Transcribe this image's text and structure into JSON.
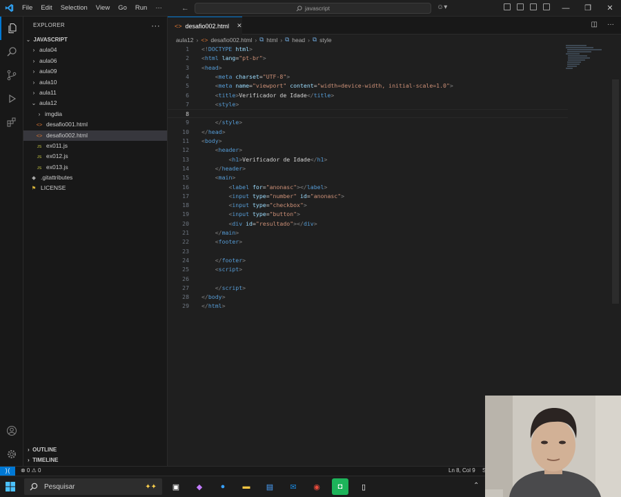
{
  "titlebar": {
    "menu": [
      "File",
      "Edit",
      "Selection",
      "View",
      "Go",
      "Run",
      "···"
    ],
    "search_text": "javascript"
  },
  "explorer": {
    "title": "EXPLORER",
    "root": "JAVASCRIPT",
    "items": [
      {
        "label": "aula04",
        "kind": "folder",
        "depth": 1,
        "open": false
      },
      {
        "label": "aula06",
        "kind": "folder",
        "depth": 1,
        "open": false
      },
      {
        "label": "aula09",
        "kind": "folder",
        "depth": 1,
        "open": false
      },
      {
        "label": "aula10",
        "kind": "folder",
        "depth": 1,
        "open": false
      },
      {
        "label": "aula11",
        "kind": "folder",
        "depth": 1,
        "open": false
      },
      {
        "label": "aula12",
        "kind": "folder",
        "depth": 1,
        "open": true
      },
      {
        "label": "imgdia",
        "kind": "folder",
        "depth": 2,
        "open": false
      },
      {
        "label": "desafio001.html",
        "kind": "html",
        "depth": 2
      },
      {
        "label": "desafio002.html",
        "kind": "html",
        "depth": 2,
        "selected": true
      },
      {
        "label": "ex011.js",
        "kind": "js",
        "depth": 2
      },
      {
        "label": "ex012.js",
        "kind": "js",
        "depth": 2
      },
      {
        "label": "ex013.js",
        "kind": "js",
        "depth": 2
      },
      {
        "label": ".gitattributes",
        "kind": "git",
        "depth": 1
      },
      {
        "label": "LICENSE",
        "kind": "license",
        "depth": 1
      }
    ],
    "outline": "OUTLINE",
    "timeline": "TIMELINE"
  },
  "tab": {
    "label": "desafio002.html"
  },
  "breadcrumb": [
    "aula12",
    "desafio002.html",
    "html",
    "head",
    "style"
  ],
  "code_lines": [
    [
      [
        "p",
        "<!"
      ],
      [
        "t",
        "DOCTYPE"
      ],
      [
        "x",
        " "
      ],
      [
        "a",
        "html"
      ],
      [
        "p",
        ">"
      ]
    ],
    [
      [
        "p",
        "<"
      ],
      [
        "t",
        "html"
      ],
      [
        "x",
        " "
      ],
      [
        "a",
        "lang"
      ],
      [
        "x",
        "="
      ],
      [
        "s",
        "\"pt-br\""
      ],
      [
        "p",
        ">"
      ]
    ],
    [
      [
        "p",
        "<"
      ],
      [
        "t",
        "head"
      ],
      [
        "p",
        ">"
      ]
    ],
    [
      [
        "x",
        "    "
      ],
      [
        "p",
        "<"
      ],
      [
        "t",
        "meta"
      ],
      [
        "x",
        " "
      ],
      [
        "a",
        "charset"
      ],
      [
        "x",
        "="
      ],
      [
        "s",
        "\"UTF-8\""
      ],
      [
        "p",
        ">"
      ]
    ],
    [
      [
        "x",
        "    "
      ],
      [
        "p",
        "<"
      ],
      [
        "t",
        "meta"
      ],
      [
        "x",
        " "
      ],
      [
        "a",
        "name"
      ],
      [
        "x",
        "="
      ],
      [
        "s",
        "\"viewport\""
      ],
      [
        "x",
        " "
      ],
      [
        "a",
        "content"
      ],
      [
        "x",
        "="
      ],
      [
        "s",
        "\"width=device-width, initial-scale=1.0\""
      ],
      [
        "p",
        ">"
      ]
    ],
    [
      [
        "x",
        "    "
      ],
      [
        "p",
        "<"
      ],
      [
        "t",
        "title"
      ],
      [
        "p",
        ">"
      ],
      [
        "x",
        "Verificador de Idade"
      ],
      [
        "p",
        "</"
      ],
      [
        "t",
        "title"
      ],
      [
        "p",
        ">"
      ]
    ],
    [
      [
        "x",
        "    "
      ],
      [
        "p",
        "<"
      ],
      [
        "t",
        "style"
      ],
      [
        "p",
        ">"
      ]
    ],
    [
      [
        "x",
        "        "
      ]
    ],
    [
      [
        "x",
        "    "
      ],
      [
        "p",
        "</"
      ],
      [
        "t",
        "style"
      ],
      [
        "p",
        ">"
      ]
    ],
    [
      [
        "p",
        "</"
      ],
      [
        "t",
        "head"
      ],
      [
        "p",
        ">"
      ]
    ],
    [
      [
        "p",
        "<"
      ],
      [
        "t",
        "body"
      ],
      [
        "p",
        ">"
      ]
    ],
    [
      [
        "x",
        "    "
      ],
      [
        "p",
        "<"
      ],
      [
        "t",
        "header"
      ],
      [
        "p",
        ">"
      ]
    ],
    [
      [
        "x",
        "        "
      ],
      [
        "p",
        "<"
      ],
      [
        "t",
        "h1"
      ],
      [
        "p",
        ">"
      ],
      [
        "x",
        "Verificador de Idade"
      ],
      [
        "p",
        "</"
      ],
      [
        "t",
        "h1"
      ],
      [
        "p",
        ">"
      ]
    ],
    [
      [
        "x",
        "    "
      ],
      [
        "p",
        "</"
      ],
      [
        "t",
        "header"
      ],
      [
        "p",
        ">"
      ]
    ],
    [
      [
        "x",
        "    "
      ],
      [
        "p",
        "<"
      ],
      [
        "t",
        "main"
      ],
      [
        "p",
        ">"
      ]
    ],
    [
      [
        "x",
        "        "
      ],
      [
        "p",
        "<"
      ],
      [
        "t",
        "label"
      ],
      [
        "x",
        " "
      ],
      [
        "a",
        "for"
      ],
      [
        "x",
        "="
      ],
      [
        "s",
        "\"anonasc\""
      ],
      [
        "p",
        "></"
      ],
      [
        "t",
        "label"
      ],
      [
        "p",
        ">"
      ]
    ],
    [
      [
        "x",
        "        "
      ],
      [
        "p",
        "<"
      ],
      [
        "t",
        "input"
      ],
      [
        "x",
        " "
      ],
      [
        "a",
        "type"
      ],
      [
        "x",
        "="
      ],
      [
        "s",
        "\"number\""
      ],
      [
        "x",
        " "
      ],
      [
        "a",
        "id"
      ],
      [
        "x",
        "="
      ],
      [
        "s",
        "\"anonasc\""
      ],
      [
        "p",
        ">"
      ]
    ],
    [
      [
        "x",
        "        "
      ],
      [
        "p",
        "<"
      ],
      [
        "t",
        "input"
      ],
      [
        "x",
        " "
      ],
      [
        "a",
        "type"
      ],
      [
        "x",
        "="
      ],
      [
        "s",
        "\"checkbox\""
      ],
      [
        "p",
        ">"
      ]
    ],
    [
      [
        "x",
        "        "
      ],
      [
        "p",
        "<"
      ],
      [
        "t",
        "input"
      ],
      [
        "x",
        " "
      ],
      [
        "a",
        "type"
      ],
      [
        "x",
        "="
      ],
      [
        "s",
        "\"button\""
      ],
      [
        "p",
        ">"
      ]
    ],
    [
      [
        "x",
        "        "
      ],
      [
        "p",
        "<"
      ],
      [
        "t",
        "div"
      ],
      [
        "x",
        " "
      ],
      [
        "a",
        "id"
      ],
      [
        "x",
        "="
      ],
      [
        "s",
        "\"resultado\""
      ],
      [
        "p",
        "></"
      ],
      [
        "t",
        "div"
      ],
      [
        "p",
        ">"
      ]
    ],
    [
      [
        "x",
        "    "
      ],
      [
        "p",
        "</"
      ],
      [
        "t",
        "main"
      ],
      [
        "p",
        ">"
      ]
    ],
    [
      [
        "x",
        "    "
      ],
      [
        "p",
        "<"
      ],
      [
        "t",
        "footer"
      ],
      [
        "p",
        ">"
      ]
    ],
    [
      [
        "x",
        ""
      ]
    ],
    [
      [
        "x",
        "    "
      ],
      [
        "p",
        "</"
      ],
      [
        "t",
        "footer"
      ],
      [
        "p",
        ">"
      ]
    ],
    [
      [
        "x",
        "    "
      ],
      [
        "p",
        "<"
      ],
      [
        "t",
        "script"
      ],
      [
        "p",
        ">"
      ]
    ],
    [
      [
        "x",
        ""
      ]
    ],
    [
      [
        "x",
        "    "
      ],
      [
        "p",
        "</"
      ],
      [
        "t",
        "script"
      ],
      [
        "p",
        ">"
      ]
    ],
    [
      [
        "p",
        "</"
      ],
      [
        "t",
        "body"
      ],
      [
        "p",
        ">"
      ]
    ],
    [
      [
        "p",
        "</"
      ],
      [
        "t",
        "html"
      ],
      [
        "p",
        ">"
      ]
    ]
  ],
  "current_line": 8,
  "statusbar": {
    "problems": "⊗ 0 ⚠ 0",
    "position": "Ln 8, Col 9",
    "encoding": "S"
  },
  "taskbar": {
    "search_placeholder": "Pesquisar"
  },
  "colors": {
    "accent": "#0078d4",
    "tag": "#569cd6",
    "attribute": "#9cdcfe",
    "string": "#ce9178",
    "html_icon": "#e37933",
    "js_icon": "#cbcb41"
  }
}
